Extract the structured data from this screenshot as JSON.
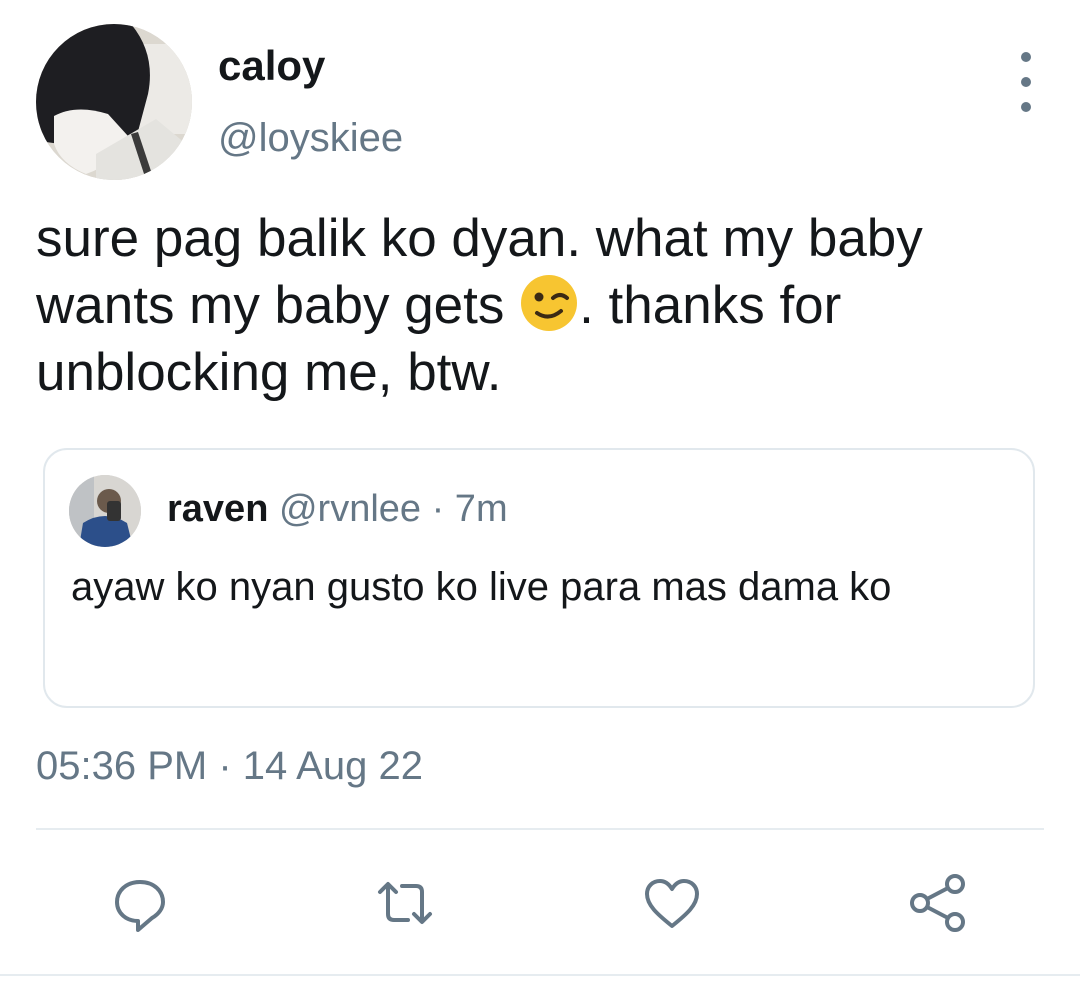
{
  "tweet": {
    "author": {
      "name": "caloy",
      "handle": "@loyskiee"
    },
    "text_before_emoji": "sure pag balik ko dyan. what my baby wants my baby gets ",
    "emoji": "winking-face",
    "text_after_emoji": ". thanks for unblocking me, btw.",
    "timestamp": "05:36 PM · 14 Aug 22"
  },
  "quoted": {
    "name": "raven",
    "meta": "@rvnlee · 7m",
    "text": "ayaw ko nyan gusto ko live para mas dama ko"
  },
  "actions": [
    {
      "name": "reply",
      "icon": "reply-icon"
    },
    {
      "name": "retweet",
      "icon": "retweet-icon"
    },
    {
      "name": "like",
      "icon": "heart-icon"
    },
    {
      "name": "share",
      "icon": "share-icon"
    }
  ],
  "colors": {
    "secondary_text": "#657786",
    "icon": "#657786",
    "border": "#e1e8ed"
  }
}
